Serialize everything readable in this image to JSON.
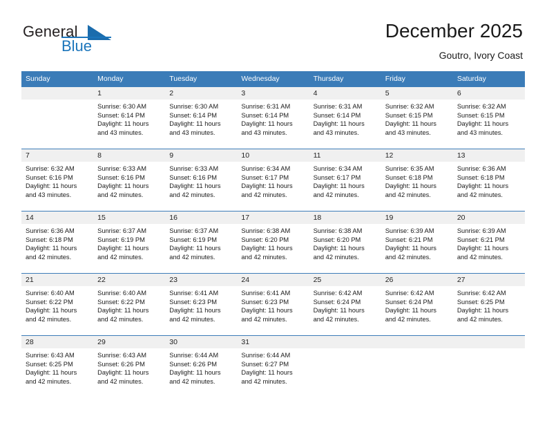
{
  "brand": {
    "word_one": "General",
    "word_two": "Blue",
    "triangle_icon": "triangle-icon",
    "accent_color": "#1b75bb"
  },
  "header": {
    "title": "December 2025",
    "subtitle": "Goutro, Ivory Coast"
  },
  "calendar": {
    "header_bg": "#3b7cb8",
    "daynum_bg": "#f0f0f0",
    "weekdays": [
      "Sunday",
      "Monday",
      "Tuesday",
      "Wednesday",
      "Thursday",
      "Friday",
      "Saturday"
    ],
    "weeks": [
      [
        {
          "day": "",
          "empty": true
        },
        {
          "day": "1",
          "sunrise": "Sunrise: 6:30 AM",
          "sunset": "Sunset: 6:14 PM",
          "daylight": "Daylight: 11 hours and 43 minutes."
        },
        {
          "day": "2",
          "sunrise": "Sunrise: 6:30 AM",
          "sunset": "Sunset: 6:14 PM",
          "daylight": "Daylight: 11 hours and 43 minutes."
        },
        {
          "day": "3",
          "sunrise": "Sunrise: 6:31 AM",
          "sunset": "Sunset: 6:14 PM",
          "daylight": "Daylight: 11 hours and 43 minutes."
        },
        {
          "day": "4",
          "sunrise": "Sunrise: 6:31 AM",
          "sunset": "Sunset: 6:14 PM",
          "daylight": "Daylight: 11 hours and 43 minutes."
        },
        {
          "day": "5",
          "sunrise": "Sunrise: 6:32 AM",
          "sunset": "Sunset: 6:15 PM",
          "daylight": "Daylight: 11 hours and 43 minutes."
        },
        {
          "day": "6",
          "sunrise": "Sunrise: 6:32 AM",
          "sunset": "Sunset: 6:15 PM",
          "daylight": "Daylight: 11 hours and 43 minutes."
        }
      ],
      [
        {
          "day": "7",
          "sunrise": "Sunrise: 6:32 AM",
          "sunset": "Sunset: 6:16 PM",
          "daylight": "Daylight: 11 hours and 43 minutes."
        },
        {
          "day": "8",
          "sunrise": "Sunrise: 6:33 AM",
          "sunset": "Sunset: 6:16 PM",
          "daylight": "Daylight: 11 hours and 42 minutes."
        },
        {
          "day": "9",
          "sunrise": "Sunrise: 6:33 AM",
          "sunset": "Sunset: 6:16 PM",
          "daylight": "Daylight: 11 hours and 42 minutes."
        },
        {
          "day": "10",
          "sunrise": "Sunrise: 6:34 AM",
          "sunset": "Sunset: 6:17 PM",
          "daylight": "Daylight: 11 hours and 42 minutes."
        },
        {
          "day": "11",
          "sunrise": "Sunrise: 6:34 AM",
          "sunset": "Sunset: 6:17 PM",
          "daylight": "Daylight: 11 hours and 42 minutes."
        },
        {
          "day": "12",
          "sunrise": "Sunrise: 6:35 AM",
          "sunset": "Sunset: 6:18 PM",
          "daylight": "Daylight: 11 hours and 42 minutes."
        },
        {
          "day": "13",
          "sunrise": "Sunrise: 6:36 AM",
          "sunset": "Sunset: 6:18 PM",
          "daylight": "Daylight: 11 hours and 42 minutes."
        }
      ],
      [
        {
          "day": "14",
          "sunrise": "Sunrise: 6:36 AM",
          "sunset": "Sunset: 6:18 PM",
          "daylight": "Daylight: 11 hours and 42 minutes."
        },
        {
          "day": "15",
          "sunrise": "Sunrise: 6:37 AM",
          "sunset": "Sunset: 6:19 PM",
          "daylight": "Daylight: 11 hours and 42 minutes."
        },
        {
          "day": "16",
          "sunrise": "Sunrise: 6:37 AM",
          "sunset": "Sunset: 6:19 PM",
          "daylight": "Daylight: 11 hours and 42 minutes."
        },
        {
          "day": "17",
          "sunrise": "Sunrise: 6:38 AM",
          "sunset": "Sunset: 6:20 PM",
          "daylight": "Daylight: 11 hours and 42 minutes."
        },
        {
          "day": "18",
          "sunrise": "Sunrise: 6:38 AM",
          "sunset": "Sunset: 6:20 PM",
          "daylight": "Daylight: 11 hours and 42 minutes."
        },
        {
          "day": "19",
          "sunrise": "Sunrise: 6:39 AM",
          "sunset": "Sunset: 6:21 PM",
          "daylight": "Daylight: 11 hours and 42 minutes."
        },
        {
          "day": "20",
          "sunrise": "Sunrise: 6:39 AM",
          "sunset": "Sunset: 6:21 PM",
          "daylight": "Daylight: 11 hours and 42 minutes."
        }
      ],
      [
        {
          "day": "21",
          "sunrise": "Sunrise: 6:40 AM",
          "sunset": "Sunset: 6:22 PM",
          "daylight": "Daylight: 11 hours and 42 minutes."
        },
        {
          "day": "22",
          "sunrise": "Sunrise: 6:40 AM",
          "sunset": "Sunset: 6:22 PM",
          "daylight": "Daylight: 11 hours and 42 minutes."
        },
        {
          "day": "23",
          "sunrise": "Sunrise: 6:41 AM",
          "sunset": "Sunset: 6:23 PM",
          "daylight": "Daylight: 11 hours and 42 minutes."
        },
        {
          "day": "24",
          "sunrise": "Sunrise: 6:41 AM",
          "sunset": "Sunset: 6:23 PM",
          "daylight": "Daylight: 11 hours and 42 minutes."
        },
        {
          "day": "25",
          "sunrise": "Sunrise: 6:42 AM",
          "sunset": "Sunset: 6:24 PM",
          "daylight": "Daylight: 11 hours and 42 minutes."
        },
        {
          "day": "26",
          "sunrise": "Sunrise: 6:42 AM",
          "sunset": "Sunset: 6:24 PM",
          "daylight": "Daylight: 11 hours and 42 minutes."
        },
        {
          "day": "27",
          "sunrise": "Sunrise: 6:42 AM",
          "sunset": "Sunset: 6:25 PM",
          "daylight": "Daylight: 11 hours and 42 minutes."
        }
      ],
      [
        {
          "day": "28",
          "sunrise": "Sunrise: 6:43 AM",
          "sunset": "Sunset: 6:25 PM",
          "daylight": "Daylight: 11 hours and 42 minutes."
        },
        {
          "day": "29",
          "sunrise": "Sunrise: 6:43 AM",
          "sunset": "Sunset: 6:26 PM",
          "daylight": "Daylight: 11 hours and 42 minutes."
        },
        {
          "day": "30",
          "sunrise": "Sunrise: 6:44 AM",
          "sunset": "Sunset: 6:26 PM",
          "daylight": "Daylight: 11 hours and 42 minutes."
        },
        {
          "day": "31",
          "sunrise": "Sunrise: 6:44 AM",
          "sunset": "Sunset: 6:27 PM",
          "daylight": "Daylight: 11 hours and 42 minutes."
        },
        {
          "day": "",
          "empty": true
        },
        {
          "day": "",
          "empty": true
        },
        {
          "day": "",
          "empty": true
        }
      ]
    ]
  }
}
